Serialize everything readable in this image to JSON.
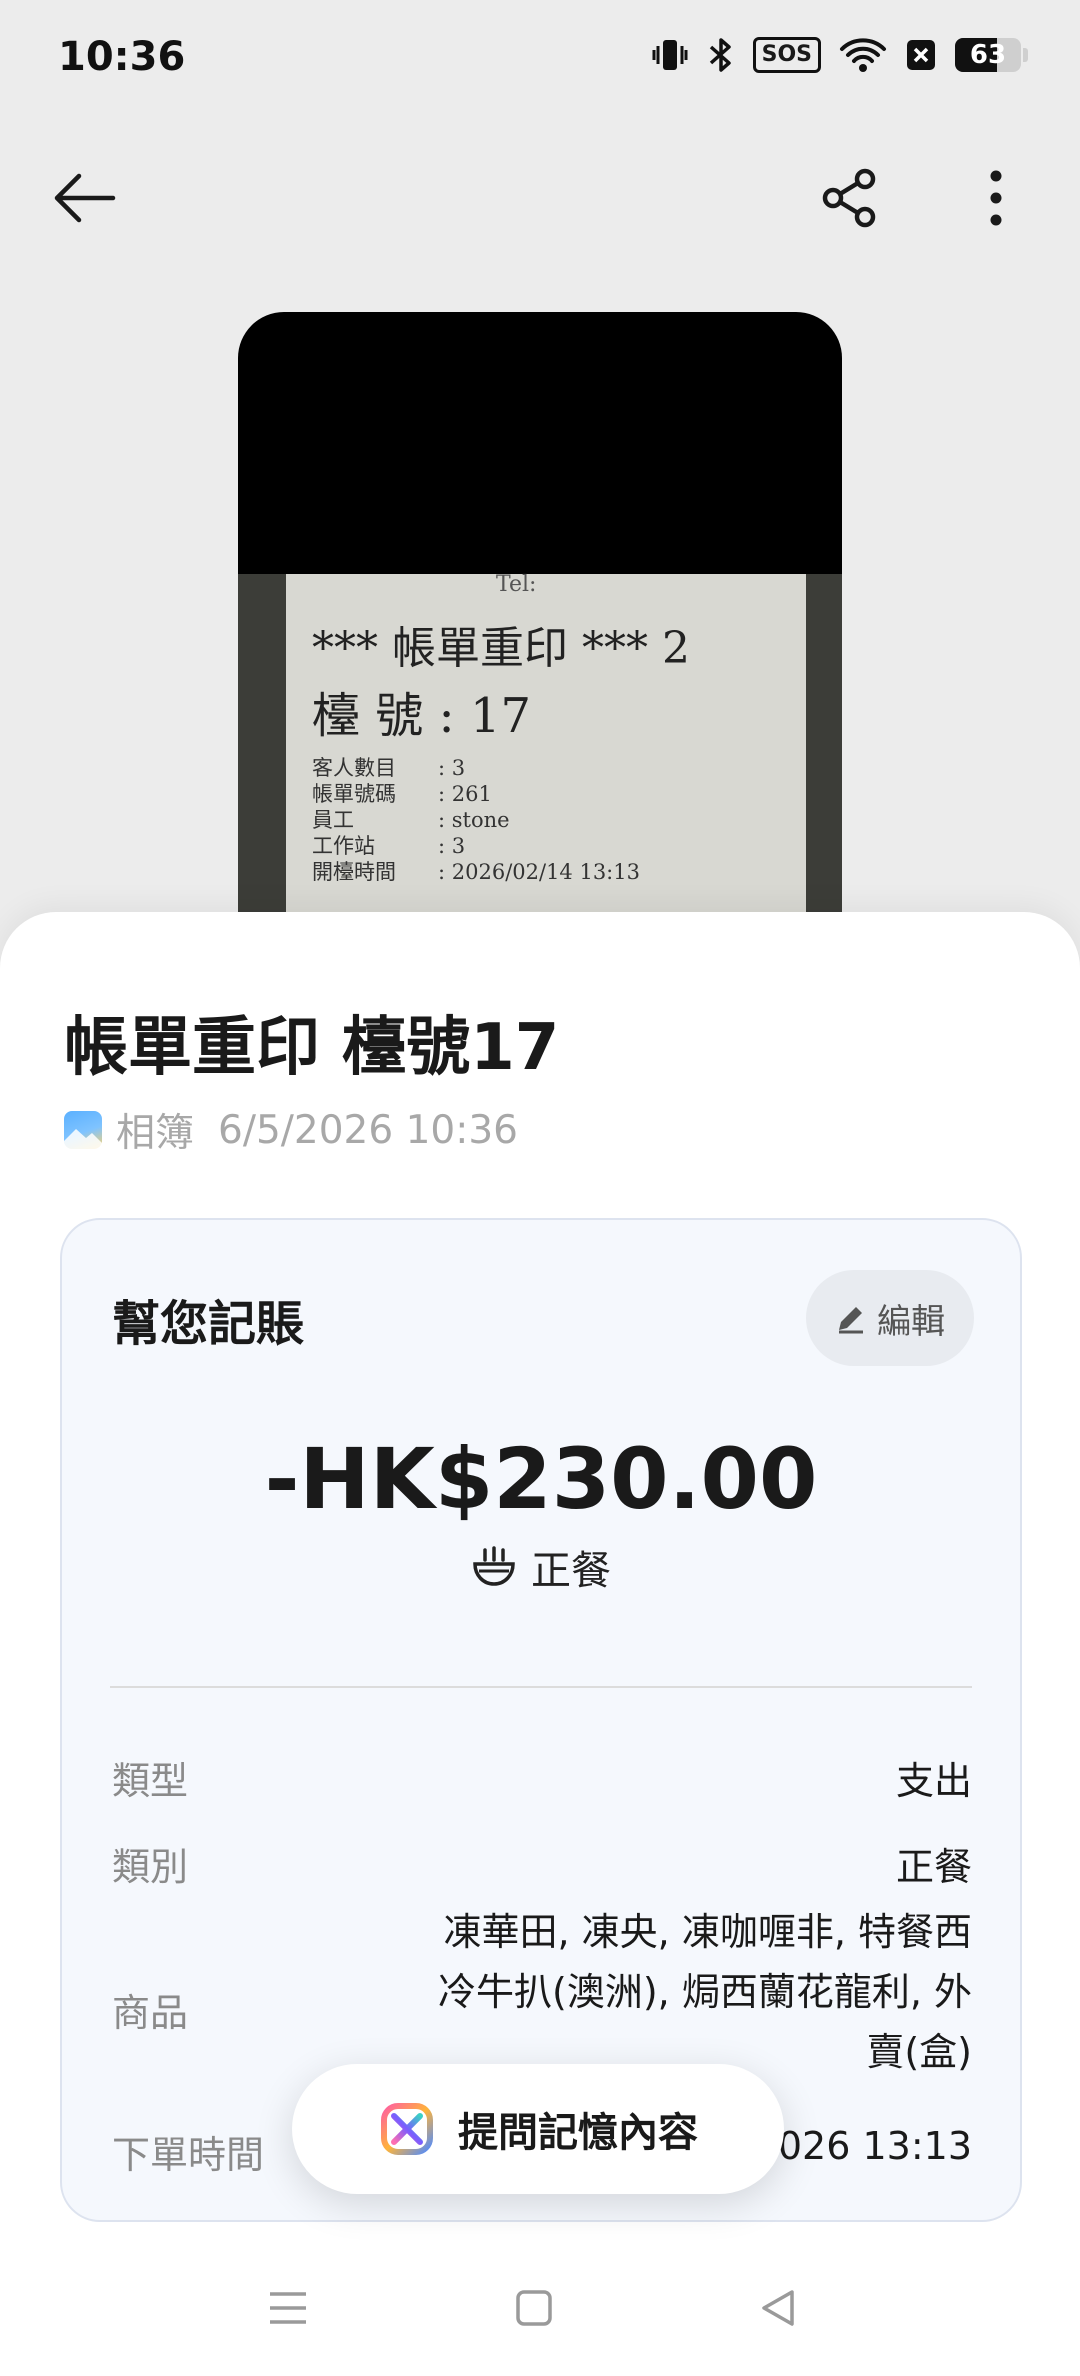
{
  "status_bar": {
    "time": "10:36",
    "sos": "SOS",
    "battery_level": "63"
  },
  "receipt_photo": {
    "tel": "Tel:",
    "line1": "*** 帳單重印 *** 2",
    "line2": "檯 號 : 17",
    "rows": [
      {
        "k": "客人數目",
        "v": ": 3"
      },
      {
        "k": "帳單號碼",
        "v": ": 261"
      },
      {
        "k": "員工",
        "v": ": stone"
      },
      {
        "k": "工作站",
        "v": ": 3"
      },
      {
        "k": "開檯時間",
        "v": ": 2026/02/14 13:13"
      }
    ]
  },
  "sheet": {
    "title": "帳單重印 檯號17",
    "source": "相簿",
    "date": "6/5/2026 10:36"
  },
  "card": {
    "title": "幫您記賬",
    "edit_label": "編輯",
    "amount": "-HK$230.00",
    "category": "正餐",
    "rows": {
      "type_label": "類型",
      "type_value": "支出",
      "category_label": "類別",
      "category_value": "正餐",
      "items_label": "商品",
      "items_value": "凍華田, 凍央, 凍咖喱非, 特餐西冷牛扒(澳洲), 焗西蘭花龍利, 外賣(盒)",
      "time_label": "下單時間",
      "time_value": "2026 13:13"
    }
  },
  "ask_button_label": "提問記憶內容",
  "colors": {
    "sheet_bg": "#ffffff",
    "card_bg": "#f5f8fd",
    "page_bg": "#ececec"
  }
}
